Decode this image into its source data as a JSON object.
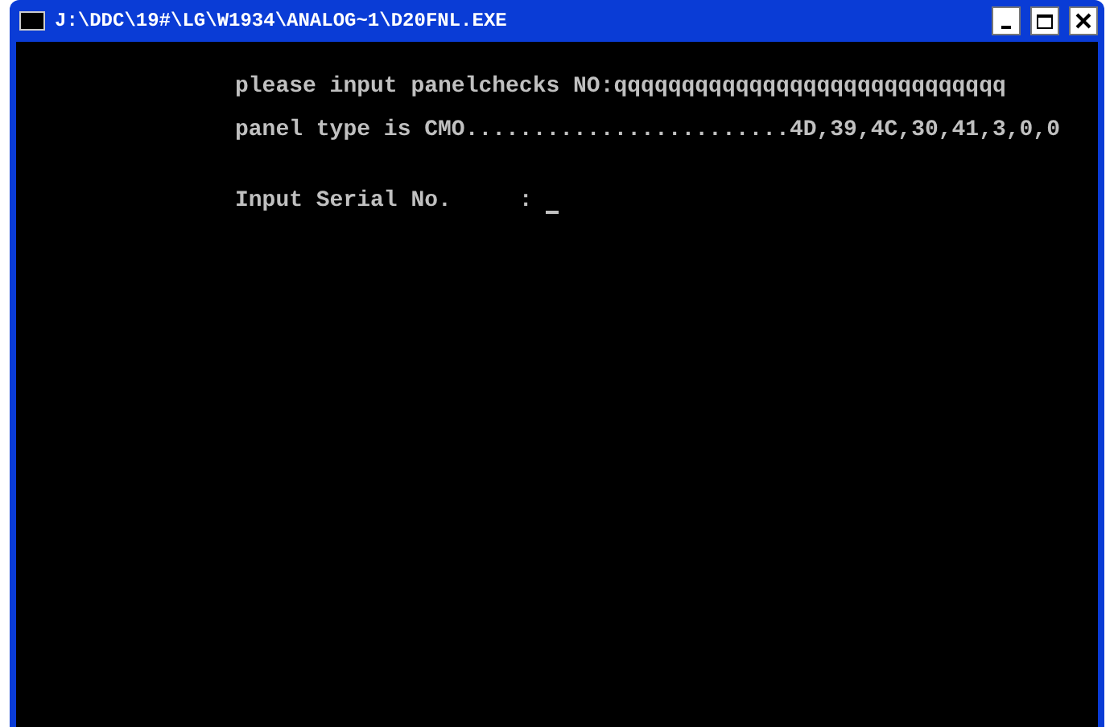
{
  "window": {
    "title": "J:\\DDC\\19#\\LG\\W1934\\ANALOG~1\\D20FNL.EXE"
  },
  "console": {
    "lines": [
      "please input panelchecks NO:qqqqqqqqqqqqqqqqqqqqqqqqqqqqq",
      "panel type is CMO........................4D,39,4C,30,41,3,0,0"
    ],
    "prompt": "Input Serial No.     :",
    "cursor": true
  }
}
